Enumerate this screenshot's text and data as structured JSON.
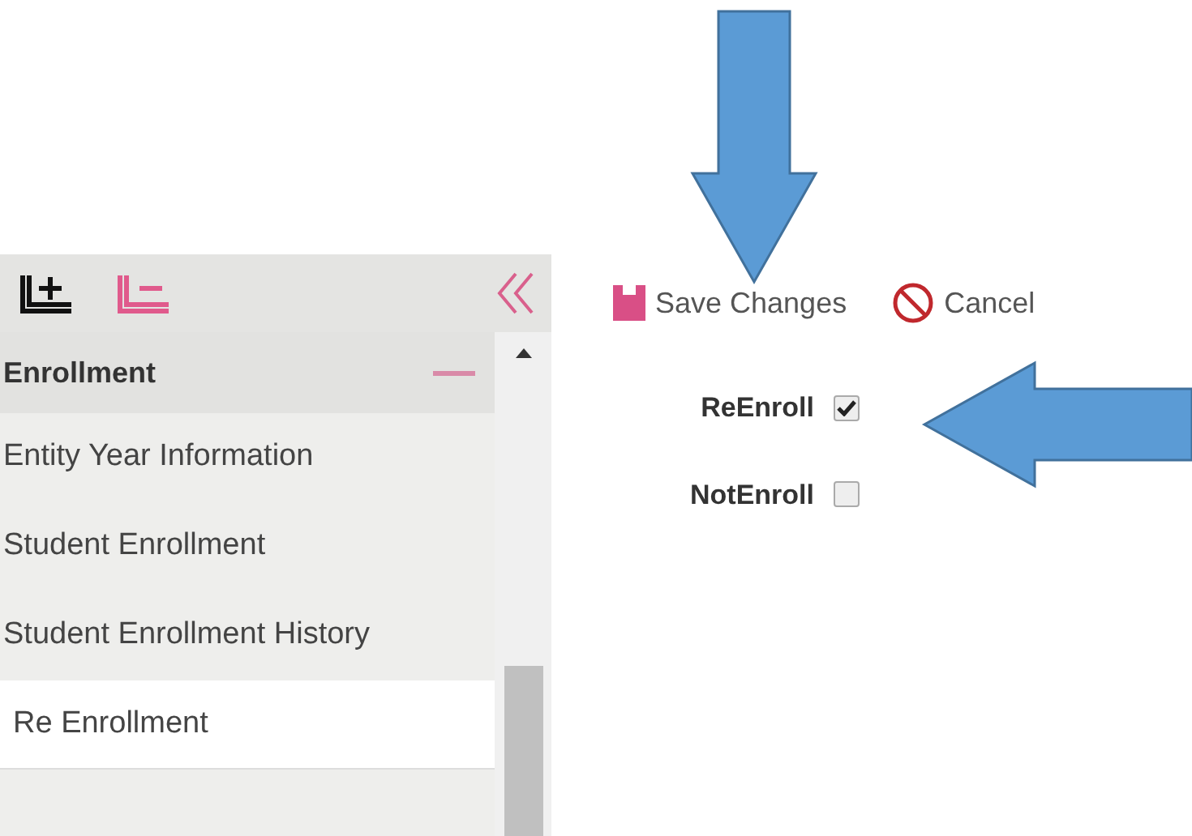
{
  "sidebar": {
    "group": {
      "label": "Enrollment",
      "expanded": true
    },
    "items": [
      {
        "label": "Entity Year Information",
        "selected": false
      },
      {
        "label": "Student Enrollment",
        "selected": false
      },
      {
        "label": "Student Enrollment History",
        "selected": false
      },
      {
        "label": "Re Enrollment",
        "selected": true
      }
    ]
  },
  "toolbar": {
    "save": "Save Changes",
    "cancel": "Cancel"
  },
  "fields": [
    {
      "label": "ReEnroll",
      "checked": true
    },
    {
      "label": "NotEnroll",
      "checked": false
    }
  ]
}
